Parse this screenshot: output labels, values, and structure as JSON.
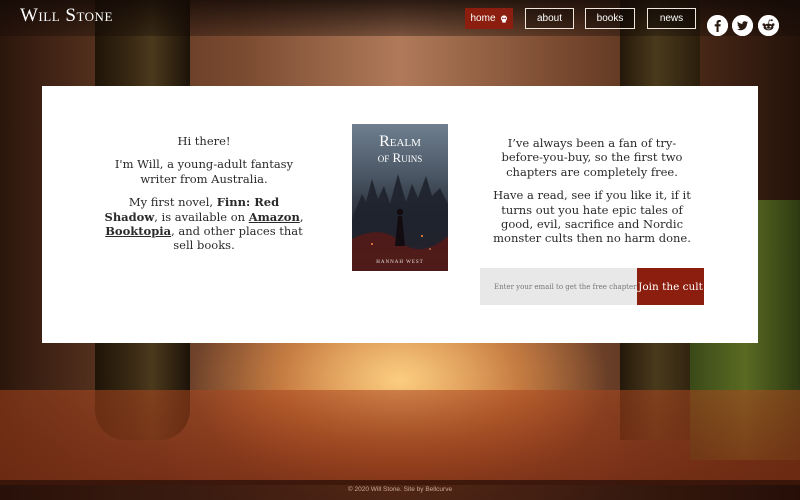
{
  "header": {
    "logo": "Will Stone",
    "nav": [
      {
        "label": "home",
        "active": true,
        "icon": "skull-icon"
      },
      {
        "label": "about",
        "active": false
      },
      {
        "label": "books",
        "active": false
      },
      {
        "label": "news",
        "active": false
      }
    ],
    "social": [
      "facebook-icon",
      "twitter-icon",
      "reddit-icon"
    ]
  },
  "intro": {
    "greeting": "Hi there!",
    "bio": "I'm Will, a young-adult fantasy writer from Australia.",
    "novel_prefix": "My first novel, ",
    "novel_title": "Finn: Red Shadow",
    "novel_mid": ", is available on ",
    "link_amazon": "Amazon",
    "comma": ", ",
    "link_booktopia": "Booktopia",
    "novel_suffix": ", and other places that sell books."
  },
  "book": {
    "title_line1": "Realm",
    "title_line2": "of Ruins",
    "author": "HANNAH WEST"
  },
  "offer": {
    "para1": "I’ve always been a fan of try-before-you-buy, so the first two chapters are completely free.",
    "para2": "Have a read, see if you like it, if it turns out you hate epic tales of good, evil, sacrifice and Nordic monster cults then no harm done.",
    "email_placeholder": "Enter your email to get the free chapters...",
    "email_value": "",
    "join_label": "Join the cult"
  },
  "footer": {
    "text": "© 2020 Will Stone. Site by Bellcurve"
  },
  "colors": {
    "accent": "#8b1e0e",
    "card": "#ffffff",
    "text": "#2a2a2a"
  }
}
